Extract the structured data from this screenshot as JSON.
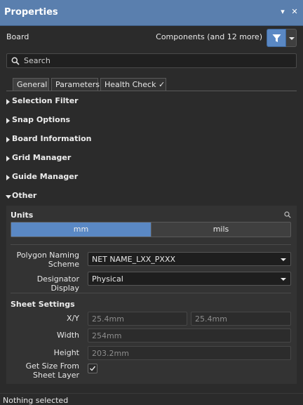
{
  "window": {
    "title": "Properties",
    "pin_glyph": "▾",
    "close_glyph": "✕"
  },
  "header": {
    "object_label": "Board",
    "components_summary": "Components (and 12 more)",
    "filter_icon": "filter-icon"
  },
  "search": {
    "placeholder": "Search"
  },
  "tabs": [
    {
      "label": "General",
      "active": true
    },
    {
      "label": "Parameters",
      "active": false
    },
    {
      "label": "Health Check",
      "active": false,
      "check_glyph": "✓"
    }
  ],
  "sections": [
    {
      "label": "Selection Filter",
      "expanded": false
    },
    {
      "label": "Snap Options",
      "expanded": false
    },
    {
      "label": "Board Information",
      "expanded": false
    },
    {
      "label": "Grid Manager",
      "expanded": false
    },
    {
      "label": "Guide Manager",
      "expanded": false
    },
    {
      "label": "Other",
      "expanded": true
    }
  ],
  "other": {
    "units": {
      "title": "Units",
      "options": [
        "mm",
        "mils"
      ],
      "selected": "mm"
    },
    "polygon_naming": {
      "label_line1": "Polygon Naming",
      "label_line2": "Scheme",
      "value": "NET NAME_LXX_PXXX"
    },
    "designator_display": {
      "label": "Designator Display",
      "value": "Physical"
    },
    "sheet_settings": {
      "title": "Sheet Settings",
      "xy_label": "X/Y",
      "x_value": "25.4mm",
      "y_value": "25.4mm",
      "width_label": "Width",
      "width_value": "254mm",
      "height_label": "Height",
      "height_value": "203.2mm",
      "get_size_label_line1": "Get Size From",
      "get_size_label_line2": "Sheet Layer",
      "get_size_checked": true
    }
  },
  "status": {
    "text": "Nothing selected"
  },
  "colors": {
    "titlebar": "#5a7fae",
    "accent": "#5a88c4",
    "panel_bg": "#2b2b2b",
    "group_bg": "#333333"
  }
}
